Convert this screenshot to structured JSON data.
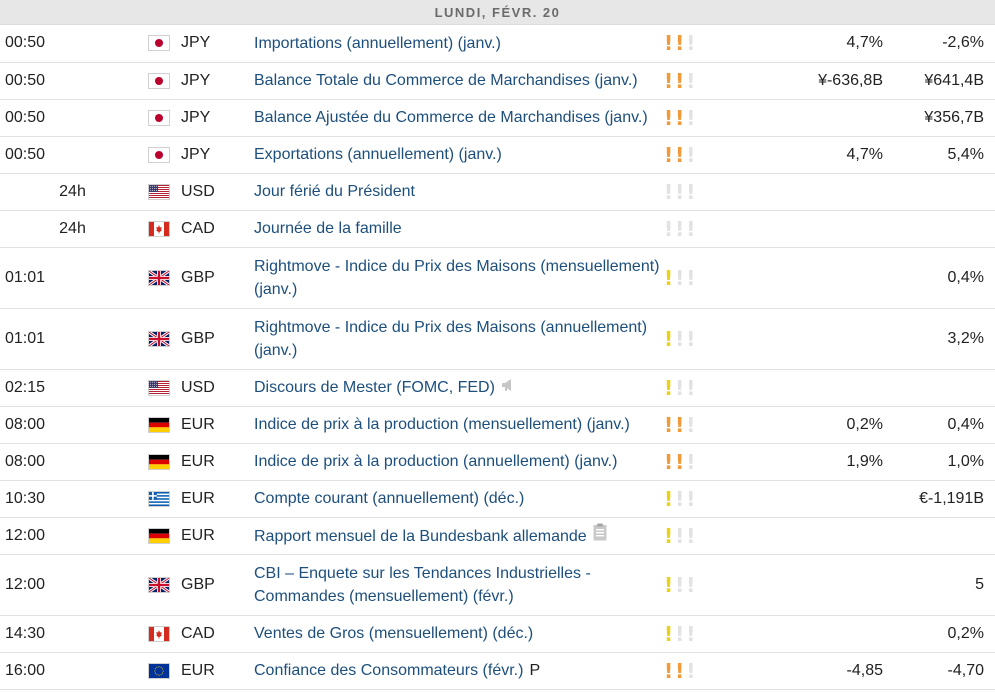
{
  "header": {
    "date": "LUNDI, FÉVR. 20"
  },
  "colors": {
    "high": "#f09a3a",
    "medium": "#e7d21c",
    "low": "#f09a3a",
    "inactive": "#e2e2e2",
    "link": "#1d4f7d"
  },
  "rows": [
    {
      "time": "00:50",
      "flag": "jp",
      "currency": "JPY",
      "event": "Importations (annuellement) (janv.)",
      "importance": 2,
      "actual": "4,7%",
      "previous": "-2,6%"
    },
    {
      "time": "00:50",
      "flag": "jp",
      "currency": "JPY",
      "event": "Balance Totale du Commerce de Marchandises (janv.)",
      "importance": 2,
      "actual": "¥-636,8B",
      "previous": "¥641,4B"
    },
    {
      "time": "00:50",
      "flag": "jp",
      "currency": "JPY",
      "event": "Balance Ajustée du Commerce de Marchandises (janv.)",
      "importance": 2,
      "actual": "",
      "previous": "¥356,7B"
    },
    {
      "time": "00:50",
      "flag": "jp",
      "currency": "JPY",
      "event": "Exportations (annuellement) (janv.)",
      "importance": 2,
      "actual": "4,7%",
      "previous": "5,4%"
    },
    {
      "time": "24h",
      "flag": "us",
      "currency": "USD",
      "event": "Jour férié du Président",
      "importance": 0,
      "actual": "",
      "previous": ""
    },
    {
      "time": "24h",
      "flag": "ca",
      "currency": "CAD",
      "event": "Journée de la famille",
      "importance": 0,
      "actual": "",
      "previous": ""
    },
    {
      "time": "01:01",
      "flag": "gb",
      "currency": "GBP",
      "event": "Rightmove - Indice du Prix des Maisons (mensuellement) (janv.)",
      "importance": 1,
      "actual": "",
      "previous": "0,4%"
    },
    {
      "time": "01:01",
      "flag": "gb",
      "currency": "GBP",
      "event": "Rightmove - Indice du Prix des Maisons (annuellement) (janv.)",
      "importance": 1,
      "actual": "",
      "previous": "3,2%"
    },
    {
      "time": "02:15",
      "flag": "us",
      "currency": "USD",
      "event": "Discours de Mester (FOMC, FED)",
      "icon": "speaker-icon",
      "importance": 1,
      "actual": "",
      "previous": ""
    },
    {
      "time": "08:00",
      "flag": "de",
      "currency": "EUR",
      "event": "Indice de prix à la production (mensuellement) (janv.)",
      "importance": 2,
      "actual": "0,2%",
      "previous": "0,4%"
    },
    {
      "time": "08:00",
      "flag": "de",
      "currency": "EUR",
      "event": "Indice de prix à la production (annuellement) (janv.)",
      "importance": 2,
      "actual": "1,9%",
      "previous": "1,0%"
    },
    {
      "time": "10:30",
      "flag": "gr",
      "currency": "EUR",
      "event": "Compte courant (annuellement) (déc.)",
      "importance": 1,
      "actual": "",
      "previous": "€-1,191B"
    },
    {
      "time": "12:00",
      "flag": "de",
      "currency": "EUR",
      "event": "Rapport mensuel de la Bundesbank allemande",
      "icon": "report-icon",
      "importance": 1,
      "actual": "",
      "previous": ""
    },
    {
      "time": "12:00",
      "flag": "gb",
      "currency": "GBP",
      "event": "CBI – Enquete sur les Tendances Industrielles - Commandes (mensuellement) (févr.)",
      "importance": 1,
      "actual": "",
      "previous": "5"
    },
    {
      "time": "14:30",
      "flag": "ca",
      "currency": "CAD",
      "event": "Ventes de Gros (mensuellement) (déc.)",
      "importance": 1,
      "actual": "",
      "previous": "0,2%"
    },
    {
      "time": "16:00",
      "flag": "eu",
      "currency": "EUR",
      "event": "Confiance des Consommateurs (févr.)",
      "icon": "preliminary-icon",
      "icon_text": "P",
      "importance": 2,
      "actual": "-4,85",
      "previous": "-4,70"
    }
  ]
}
